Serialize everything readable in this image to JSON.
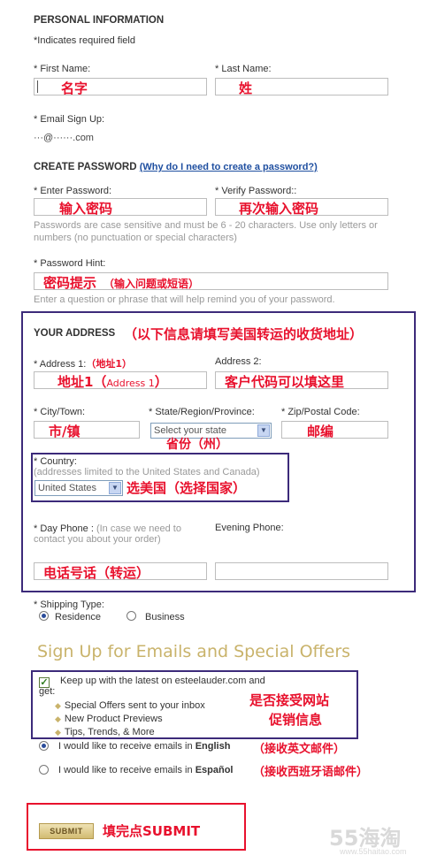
{
  "personal": {
    "heading": "PERSONAL INFORMATION",
    "required_note": "*Indicates required field",
    "first_name_label": "* First Name:",
    "first_name_value": "名字",
    "last_name_label": "* Last Name:",
    "last_name_value": "姓",
    "email_label": "* Email Sign Up:",
    "email_value": "···@······.com"
  },
  "password": {
    "heading": "CREATE PASSWORD",
    "why_link": "(Why do I need to create a password?)",
    "enter_label": "* Enter Password:",
    "enter_value": "输入密码",
    "verify_label": "* Verify Password::",
    "verify_value": "再次输入密码",
    "rules_hint": "Passwords are case sensitive and must be 6 - 20 characters. Use only letters or numbers (no punctuation or special characters)",
    "hint_label": "* Password Hint:",
    "hint_value": "密码提示",
    "hint_value_small": "（输入问题或短语）",
    "hint_help": "Enter a question or phrase that will help remind you of your password."
  },
  "address": {
    "heading": "YOUR ADDRESS",
    "annotation": "（以下信息请填写美国转运的收货地址）",
    "address1_label": "* Address 1:",
    "address1_label_ann": "（地址1）",
    "address1_value": "地址1（",
    "address1_value_en": "Address 1",
    "address1_value_end": "）",
    "address2_label": "Address 2:",
    "address2_value": "客户代码可以填这里",
    "city_label": "* City/Town:",
    "city_value": "市/镇",
    "state_label": "* State/Region/Province:",
    "state_select": "Select your state",
    "state_annotation": "省份（州）",
    "zip_label": "* Zip/Postal Code:",
    "zip_value": "邮编",
    "country_label": "* Country:",
    "country_hint": "(addresses limited to the United States and Canada)",
    "country_select": "United States",
    "country_annotation": "选美国（选择国家）",
    "day_phone_label": "* Day Phone :",
    "day_phone_hint_a": "(In case we need to",
    "day_phone_hint_b": "contact you about your order)",
    "day_phone_value": "电话号话（转运）",
    "evening_phone_label": "Evening Phone:"
  },
  "shipping": {
    "label": "* Shipping Type:",
    "options": [
      "Residence",
      "Business"
    ],
    "selected": "Residence"
  },
  "emails": {
    "heading": "Sign Up for Emails and Special Offers",
    "keep_up_a": "Keep up with the latest on esteelauder.com and",
    "keep_up_b": "get:",
    "benefits": [
      "Special Offers sent to your inbox",
      "New Product Previews",
      "Tips, Trends, & More"
    ],
    "annotation_a": "是否接受网站",
    "annotation_b": "促销信息",
    "english_prefix": "I would like to receive emails in ",
    "english_lang": "English",
    "english_annotation": "（接收英文邮件）",
    "spanish_prefix": "I would like to receive emails in ",
    "spanish_lang": "Español",
    "spanish_annotation": "（接收西班牙语邮件）"
  },
  "submit": {
    "button": "SUBMIT",
    "annotation": "填完点SUBMIT"
  },
  "watermark": {
    "text": "55海淘",
    "url": "www.55haitao.com"
  },
  "colors": {
    "annotation_red": "#e8112d",
    "frame_purple": "#3c2a7a",
    "heading_gold": "#c9b36b",
    "link_blue": "#1f4fa0"
  }
}
